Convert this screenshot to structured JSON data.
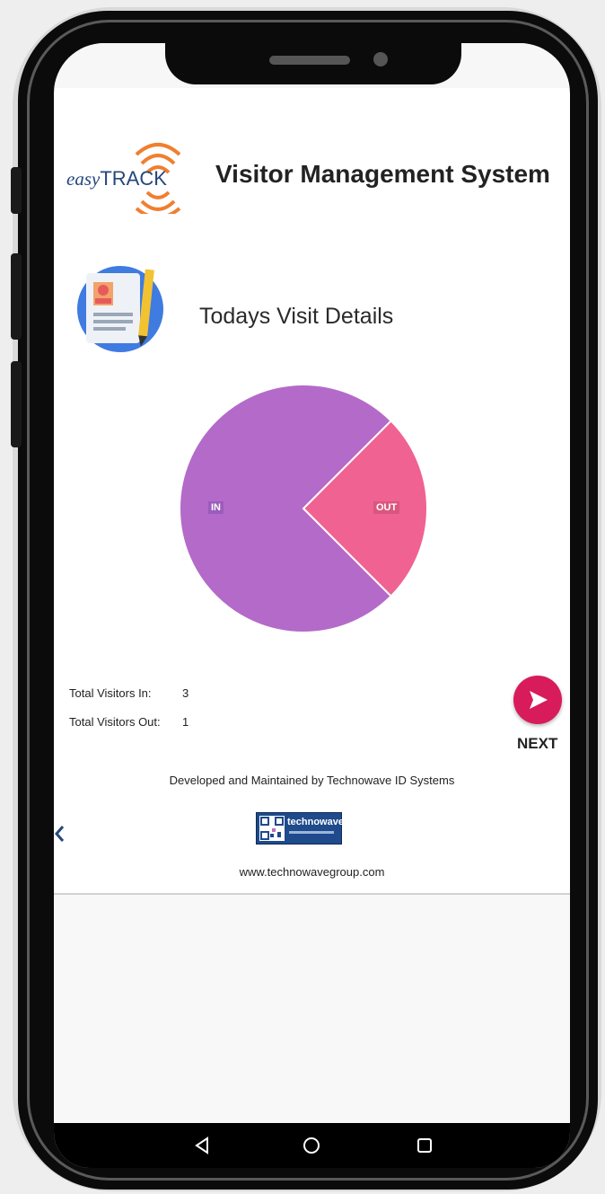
{
  "app": {
    "logo_prefix": "easy",
    "logo_main": "TRACK",
    "title": "Visitor Management System"
  },
  "section": {
    "title": "Todays Visit Details",
    "icon": "visitor-document-icon"
  },
  "chart_data": {
    "type": "pie",
    "categories": [
      "IN",
      "OUT"
    ],
    "values": [
      3,
      1
    ],
    "colors": [
      "#b46ac9",
      "#f06292"
    ]
  },
  "stats": {
    "in_label": "Total Visitors In:",
    "in_value": "3",
    "out_label": "Total Visitors Out:",
    "out_value": "1"
  },
  "next": {
    "label": "NEXT",
    "icon": "send-arrow-icon"
  },
  "footer": {
    "credit": "Developed and Maintained by Technowave ID Systems",
    "brand": "technowave",
    "website": "www.technowavegroup.com"
  },
  "nav": {
    "back": "back-triangle-icon",
    "home": "home-circle-icon",
    "recents": "recents-square-icon"
  }
}
